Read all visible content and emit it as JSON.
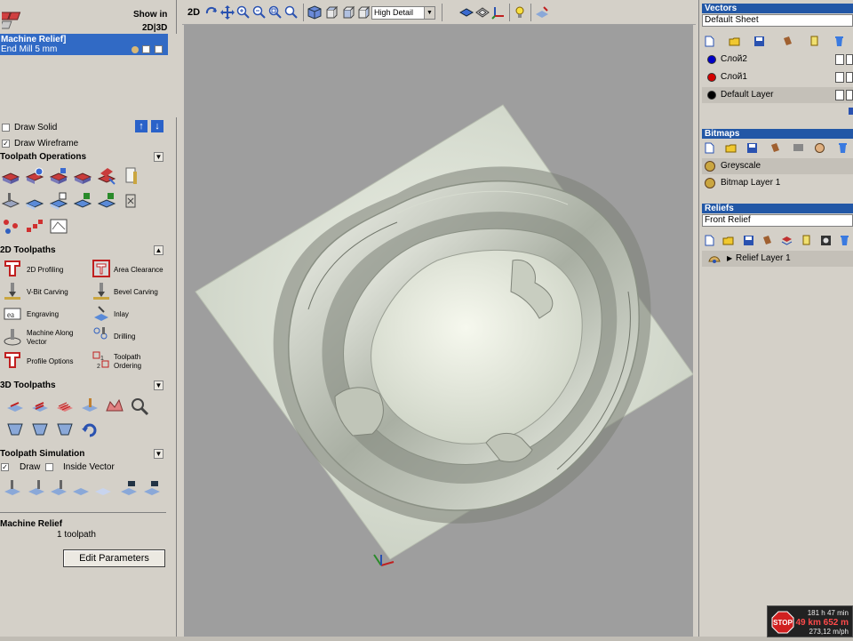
{
  "left_panel": {
    "show_in_label": "Show in",
    "show_in_modes": "2D|3D",
    "selected_toolpath": {
      "name": "Machine Relief]",
      "tool": "End Mill 5 mm"
    },
    "draw_solid_label": "Draw Solid",
    "draw_wireframe_label": "Draw Wireframe",
    "sections": {
      "toolpath_operations": "Toolpath Operations",
      "toolpaths_2d": "2D Toolpaths",
      "toolpaths_3d": "3D Toolpaths",
      "toolpath_simulation": "Toolpath Simulation"
    },
    "toolpaths_2d_items": {
      "profiling": "2D Profiling",
      "area_clearance": "Area Clearance",
      "vbit": "V-Bit Carving",
      "bevel": "Bevel Carving",
      "engraving": "Engraving",
      "inlay": "Inlay",
      "machine_along_vector": "Machine Along\nVector",
      "drilling": "Drilling",
      "profile_options": "Profile Options",
      "toolpath_ordering": "Toolpath\nOrdering"
    },
    "simulation": {
      "draw_label": "Draw",
      "inside_vector_label": "Inside Vector"
    },
    "summary": {
      "title": "Machine Relief",
      "count": "1 toolpath"
    },
    "edit_parameters_label": "Edit Parameters"
  },
  "toolbar": {
    "mode_label": "2D",
    "detail_select": "High Detail"
  },
  "right_panel": {
    "vectors": {
      "title": "Vectors",
      "sheet": "Default Sheet",
      "layers": [
        {
          "name": "Слой2",
          "color": "#0000c8"
        },
        {
          "name": "Слой1",
          "color": "#d40000"
        },
        {
          "name": "Default Layer",
          "color": "#000000"
        }
      ]
    },
    "bitmaps": {
      "title": "Bitmaps",
      "layers": [
        "Greyscale",
        "Bitmap Layer 1"
      ]
    },
    "reliefs": {
      "title": "Reliefs",
      "selected": "Front Relief",
      "layers": [
        "Relief Layer 1"
      ]
    }
  },
  "overlay": {
    "stop_label": "STOP",
    "time": "181 h 47 min",
    "distance": "49 km 652 m",
    "speed": "273,12 m/ph"
  },
  "colors": {
    "selection_blue": "#316ac5",
    "panel_header_blue": "#2257a6",
    "viewport_bg": "#9e9e9e",
    "relief_plate": "#d6dcd1"
  }
}
